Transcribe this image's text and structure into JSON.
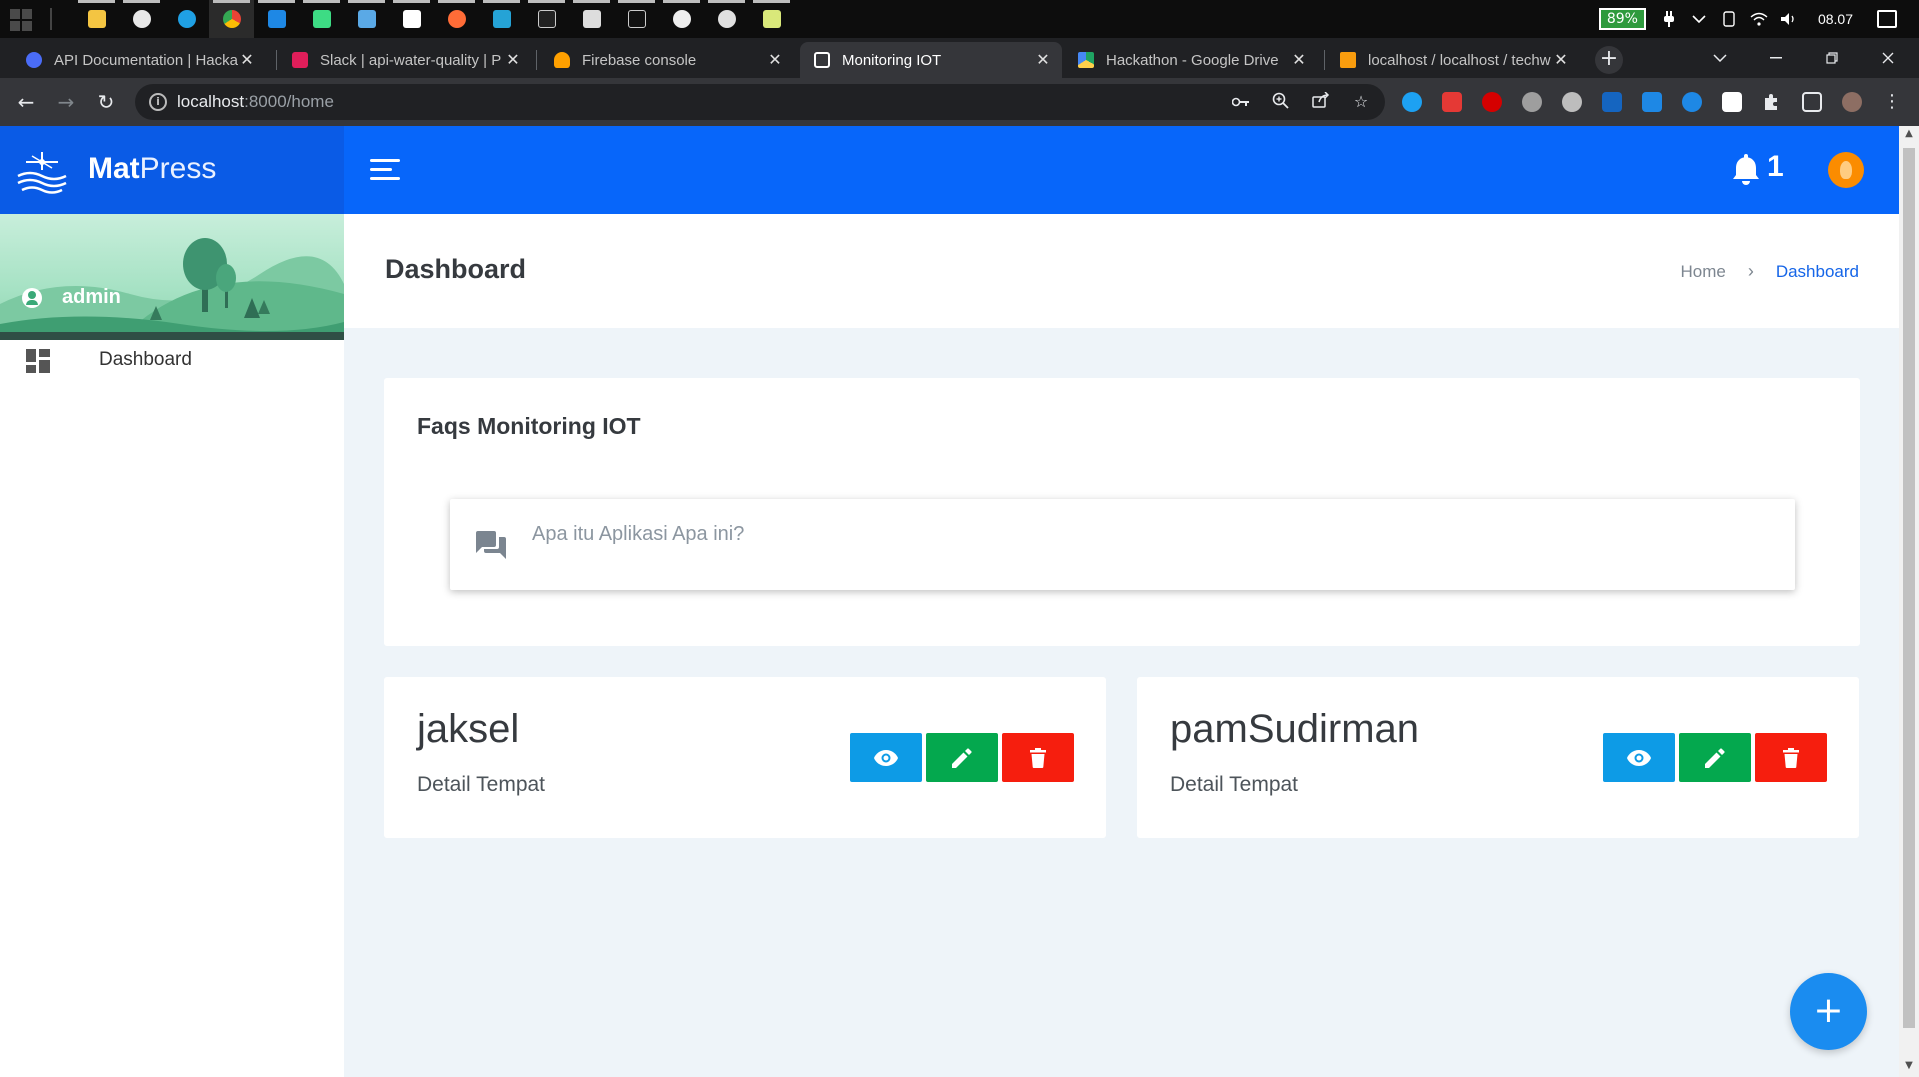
{
  "browser": {
    "tabs": [
      {
        "title": "API Documentation | Hacka",
        "favicon_color": "#4a6cf7"
      },
      {
        "title": "Slack | api-water-quality | P",
        "favicon_color": "#e01e5a"
      },
      {
        "title": "Firebase console",
        "favicon_color": "#ffa000"
      },
      {
        "title": "Monitoring IOT",
        "favicon_color": "#ffffff"
      },
      {
        "title": "Hackathon - Google Drive",
        "favicon_color": "#1fa463"
      },
      {
        "title": "localhost / localhost / techw",
        "favicon_color": "#f89c0e"
      }
    ],
    "url_host": "localhost",
    "url_path": ":8000/home"
  },
  "system": {
    "battery": "89%",
    "time": "08.07"
  },
  "app": {
    "brand_bold": "Mat",
    "brand_light": "Press",
    "notification_count": "1",
    "username": "admin",
    "nav": [
      {
        "label": "Dashboard",
        "icon": "dashboard-icon"
      }
    ],
    "page_title": "Dashboard",
    "breadcrumb": {
      "home": "Home",
      "current": "Dashboard"
    },
    "faq": {
      "title": "Faqs Monitoring IOT",
      "questions": [
        "Apa itu Aplikasi Apa ini?"
      ]
    },
    "places": [
      {
        "name": "jaksel",
        "subtitle": "Detail Tempat"
      },
      {
        "name": "pamSudirman",
        "subtitle": "Detail Tempat"
      }
    ],
    "colors": {
      "topbar": "#0766fa",
      "view": "#0d9be6",
      "edit": "#04a84e",
      "delete": "#f61e0e",
      "fab": "#1a8cf0"
    }
  }
}
